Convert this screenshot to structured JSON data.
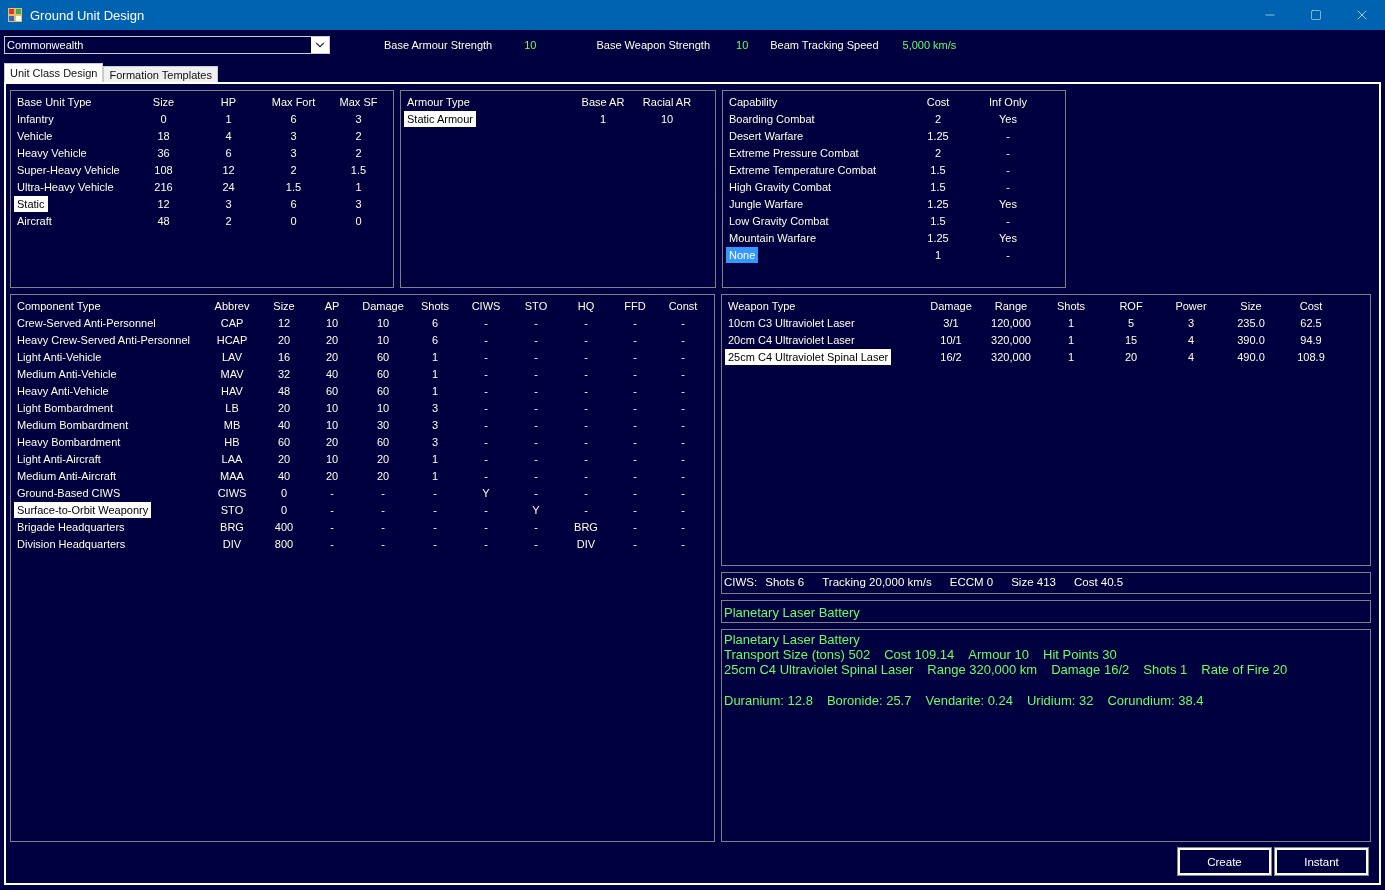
{
  "window": {
    "title": "Ground Unit Design"
  },
  "race_select": {
    "value": "Commonwealth"
  },
  "stats": [
    {
      "label": "Base Armour Strength",
      "value": "10"
    },
    {
      "label": "Base Weapon Strength",
      "value": "10"
    },
    {
      "label": "Beam Tracking Speed",
      "value": "5,000 km/s"
    }
  ],
  "tabs": [
    {
      "label": "Unit Class Design",
      "selected": true
    },
    {
      "label": "Formation Templates",
      "selected": false
    }
  ],
  "base_unit_table": {
    "focused": false,
    "columns": [
      "Base Unit Type",
      "Size",
      "HP",
      "Max Fort",
      "Max SF"
    ],
    "rows": [
      {
        "cells": [
          "Infantry",
          "0",
          "1",
          "6",
          "3"
        ],
        "selected": false
      },
      {
        "cells": [
          "Vehicle",
          "18",
          "4",
          "3",
          "2"
        ],
        "selected": false
      },
      {
        "cells": [
          "Heavy Vehicle",
          "36",
          "6",
          "3",
          "2"
        ],
        "selected": false
      },
      {
        "cells": [
          "Super-Heavy Vehicle",
          "108",
          "12",
          "2",
          "1.5"
        ],
        "selected": false
      },
      {
        "cells": [
          "Ultra-Heavy Vehicle",
          "216",
          "24",
          "1.5",
          "1"
        ],
        "selected": false
      },
      {
        "cells": [
          "Static",
          "12",
          "3",
          "6",
          "3"
        ],
        "selected": true
      },
      {
        "cells": [
          "Aircraft",
          "48",
          "2",
          "0",
          "0"
        ],
        "selected": false
      }
    ]
  },
  "armour_table": {
    "focused": false,
    "columns": [
      "Armour Type",
      "Base AR",
      "Racial AR"
    ],
    "rows": [
      {
        "cells": [
          "Static Armour",
          "1",
          "10"
        ],
        "selected": true
      }
    ]
  },
  "capability_table": {
    "focused": true,
    "columns": [
      "Capability",
      "Cost",
      "Inf Only"
    ],
    "rows": [
      {
        "cells": [
          "Boarding Combat",
          "2",
          "Yes"
        ],
        "selected": false
      },
      {
        "cells": [
          "Desert Warfare",
          "1.25",
          "-"
        ],
        "selected": false
      },
      {
        "cells": [
          "Extreme Pressure Combat",
          "2",
          "-"
        ],
        "selected": false
      },
      {
        "cells": [
          "Extreme Temperature Combat",
          "1.5",
          "-"
        ],
        "selected": false
      },
      {
        "cells": [
          "High Gravity Combat",
          "1.5",
          "-"
        ],
        "selected": false
      },
      {
        "cells": [
          "Jungle Warfare",
          "1.25",
          "Yes"
        ],
        "selected": false
      },
      {
        "cells": [
          "Low Gravity Combat",
          "1.5",
          "-"
        ],
        "selected": false
      },
      {
        "cells": [
          "Mountain Warfare",
          "1.25",
          "Yes"
        ],
        "selected": false
      },
      {
        "cells": [
          "None",
          "1",
          "-"
        ],
        "selected": true
      }
    ]
  },
  "component_table": {
    "focused": false,
    "columns": [
      "Component Type",
      "Abbrev",
      "Size",
      "AP",
      "Damage",
      "Shots",
      "CIWS",
      "STO",
      "HQ",
      "FFD",
      "Const"
    ],
    "rows": [
      {
        "cells": [
          "Crew-Served Anti-Personnel",
          "CAP",
          "12",
          "10",
          "10",
          "6",
          "-",
          "-",
          "-",
          "-",
          "-"
        ],
        "selected": false
      },
      {
        "cells": [
          "Heavy Crew-Served Anti-Personnel",
          "HCAP",
          "20",
          "20",
          "10",
          "6",
          "-",
          "-",
          "-",
          "-",
          "-"
        ],
        "selected": false
      },
      {
        "cells": [
          "Light Anti-Vehicle",
          "LAV",
          "16",
          "20",
          "60",
          "1",
          "-",
          "-",
          "-",
          "-",
          "-"
        ],
        "selected": false
      },
      {
        "cells": [
          "Medium Anti-Vehicle",
          "MAV",
          "32",
          "40",
          "60",
          "1",
          "-",
          "-",
          "-",
          "-",
          "-"
        ],
        "selected": false
      },
      {
        "cells": [
          "Heavy Anti-Vehicle",
          "HAV",
          "48",
          "60",
          "60",
          "1",
          "-",
          "-",
          "-",
          "-",
          "-"
        ],
        "selected": false
      },
      {
        "cells": [
          "Light Bombardment",
          "LB",
          "20",
          "10",
          "10",
          "3",
          "-",
          "-",
          "-",
          "-",
          "-"
        ],
        "selected": false
      },
      {
        "cells": [
          "Medium Bombardment",
          "MB",
          "40",
          "10",
          "30",
          "3",
          "-",
          "-",
          "-",
          "-",
          "-"
        ],
        "selected": false
      },
      {
        "cells": [
          "Heavy Bombardment",
          "HB",
          "60",
          "20",
          "60",
          "3",
          "-",
          "-",
          "-",
          "-",
          "-"
        ],
        "selected": false
      },
      {
        "cells": [
          "Light Anti-Aircraft",
          "LAA",
          "20",
          "10",
          "20",
          "1",
          "-",
          "-",
          "-",
          "-",
          "-"
        ],
        "selected": false
      },
      {
        "cells": [
          "Medium Anti-Aircraft",
          "MAA",
          "40",
          "20",
          "20",
          "1",
          "-",
          "-",
          "-",
          "-",
          "-"
        ],
        "selected": false
      },
      {
        "cells": [
          "Ground-Based CIWS",
          "CIWS",
          "0",
          "-",
          "-",
          "-",
          "Y",
          "-",
          "-",
          "-",
          "-"
        ],
        "selected": false
      },
      {
        "cells": [
          "Surface-to-Orbit Weaponry",
          "STO",
          "0",
          "-",
          "-",
          "-",
          "-",
          "Y",
          "-",
          "-",
          "-"
        ],
        "selected": true
      },
      {
        "cells": [
          "Brigade Headquarters",
          "BRG",
          "400",
          "-",
          "-",
          "-",
          "-",
          "-",
          "BRG",
          "-",
          "-"
        ],
        "selected": false
      },
      {
        "cells": [
          "Division Headquarters",
          "DIV",
          "800",
          "-",
          "-",
          "-",
          "-",
          "-",
          "DIV",
          "-",
          "-"
        ],
        "selected": false
      }
    ]
  },
  "weapon_table": {
    "focused": false,
    "columns": [
      "Weapon Type",
      "Damage",
      "Range",
      "Shots",
      "ROF",
      "Power",
      "Size",
      "Cost"
    ],
    "rows": [
      {
        "cells": [
          "10cm C3 Ultraviolet Laser",
          "3/1",
          "120,000",
          "1",
          "5",
          "3",
          "235.0",
          "62.5"
        ],
        "selected": false
      },
      {
        "cells": [
          "20cm C4 Ultraviolet Laser",
          "10/1",
          "320,000",
          "1",
          "15",
          "4",
          "390.0",
          "94.9"
        ],
        "selected": false
      },
      {
        "cells": [
          "25cm C4 Ultraviolet Spinal Laser",
          "16/2",
          "320,000",
          "1",
          "20",
          "4",
          "490.0",
          "108.9"
        ],
        "selected": true
      }
    ]
  },
  "ciws_line": [
    "CIWS:",
    "Shots 6",
    "Tracking 20,000 km/s",
    "ECCM 0",
    "Size 413",
    "Cost 40.5"
  ],
  "unit_name": {
    "value": "Planetary Laser Battery"
  },
  "summary": {
    "groups": [
      {
        "lines": [
          [
            "Planetary Laser Battery"
          ],
          [
            "Transport Size (tons) 502",
            "Cost 109.14",
            "Armour 10",
            "Hit Points 30"
          ],
          [
            "25cm C4 Ultraviolet Spinal Laser",
            "Range 320,000 km",
            "Damage 16/2",
            "Shots 1",
            "Rate of Fire 20"
          ]
        ]
      },
      {
        "lines": [
          [
            "Duranium: 12.8",
            "Boronide: 25.7",
            "Vendarite: 0.24",
            "Uridium: 32",
            "Corundium: 38.4"
          ]
        ]
      }
    ]
  },
  "buttons": [
    "Create",
    "Instant"
  ]
}
